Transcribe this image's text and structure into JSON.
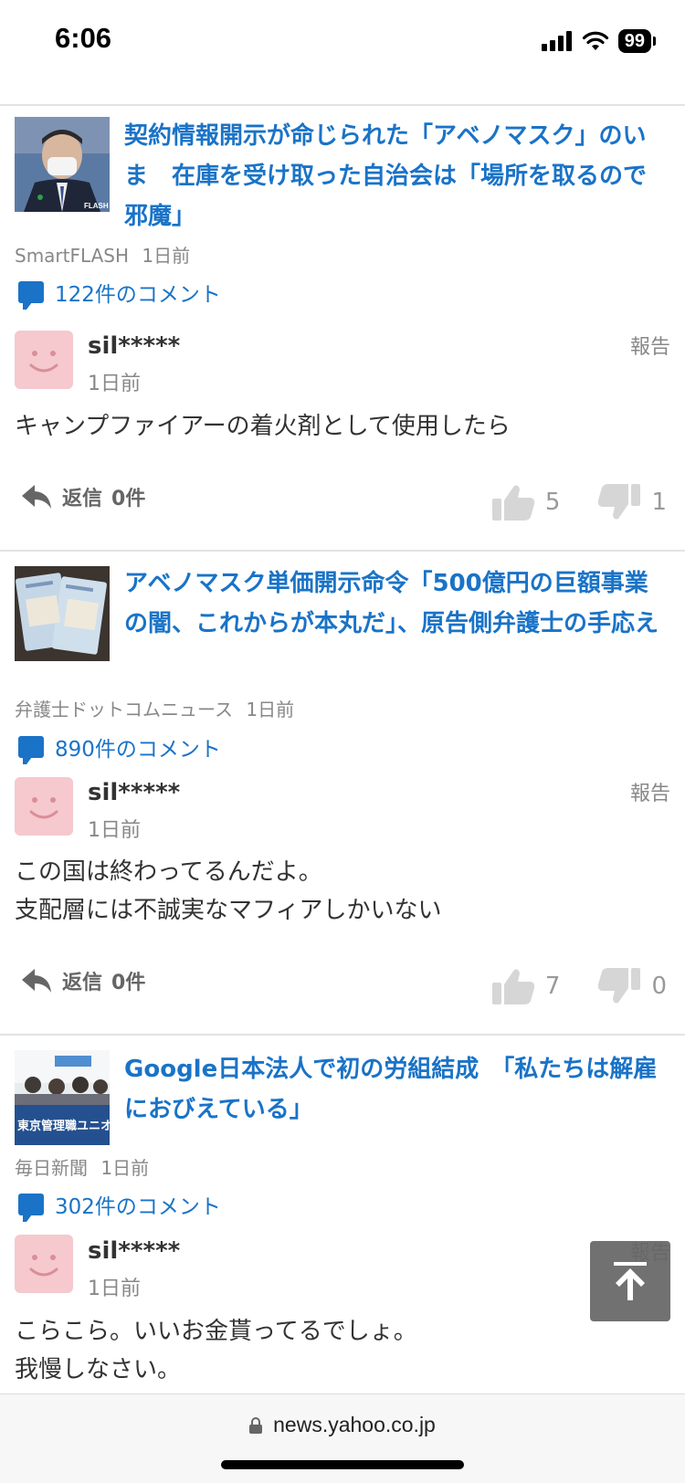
{
  "status": {
    "time": "6:06",
    "battery": "99"
  },
  "articles": [
    {
      "headline": "契約情報開示が命じられた「アベノマスク」のいま　在庫を受け取った自治会は「場所を取るので邪魔」",
      "thumb_label": "FLASH",
      "source": "SmartFLASH",
      "time": "1日前",
      "comments": "122件のコメント",
      "user": "sil*****",
      "user_time": "1日前",
      "report": "報告",
      "comment": "キャンプファイアーの着火剤として使用したら",
      "reply_label": "返信",
      "reply_count": "0件",
      "likes": "5",
      "dislikes": "1"
    },
    {
      "headline": "アベノマスク単価開示命令「500億円の巨額事業の闇、これからが本丸だ」、原告側弁護士の手応え",
      "source": "弁護士ドットコムニュース",
      "time": "1日前",
      "comments": "890件のコメント",
      "user": "sil*****",
      "user_time": "1日前",
      "report": "報告",
      "comment_line1": "この国は終わってるんだよ。",
      "comment_line2": "支配層には不誠実なマフィアしかいない",
      "reply_label": "返信",
      "reply_count": "0件",
      "likes": "7",
      "dislikes": "0"
    },
    {
      "headline": "Google日本法人で初の労組結成　「私たちは解雇におびえている」",
      "thumb_label": "東京管理職ユニオン",
      "source": "毎日新聞",
      "time": "1日前",
      "comments": "302件のコメント",
      "user": "sil*****",
      "user_time": "1日前",
      "report": "報告",
      "comment_line1": "こらこら。いいお金貰ってるでしょ。",
      "comment_line2": "我慢しなさい。"
    }
  ],
  "browser": {
    "url": "news.yahoo.co.jp"
  },
  "colors": {
    "link": "#1a73c7",
    "avatar": "#f5c9cd",
    "muted": "#888888"
  }
}
